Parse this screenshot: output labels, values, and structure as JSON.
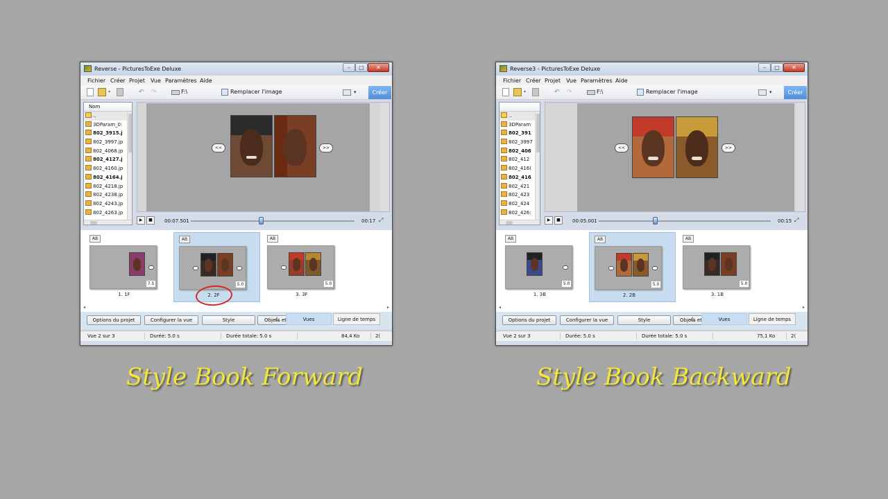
{
  "colors": {
    "background": "#a7a7a7",
    "caption": "#f3e63a",
    "selection": "#c7dcef",
    "create_button": "#5b9be3",
    "annotation": "#d62828"
  },
  "windows": [
    {
      "title": "Reverse - PicturesToExe Deluxe",
      "menu": [
        "Fichier",
        "Créer",
        "Projet",
        "Vue",
        "Paramètres",
        "Aide"
      ],
      "toolbar": {
        "drive": "F:\\",
        "replace_image": "Remplacer l'image",
        "create": "Créer",
        "undo_icon": "undo-icon",
        "redo_icon": "redo-icon"
      },
      "file_panel": {
        "header": "Nom",
        "items": [
          {
            "name": "..",
            "type": "folder",
            "bold": false
          },
          {
            "name": "3DParam_0:",
            "type": "file",
            "bold": false
          },
          {
            "name": "802_3915.j",
            "type": "file",
            "bold": true
          },
          {
            "name": "802_3997.jp",
            "type": "file",
            "bold": false
          },
          {
            "name": "802_4068.jp",
            "type": "file",
            "bold": false
          },
          {
            "name": "802_4127.j",
            "type": "file",
            "bold": true
          },
          {
            "name": "802_4160.jp",
            "type": "file",
            "bold": false
          },
          {
            "name": "802_4164.j",
            "type": "file",
            "bold": true
          },
          {
            "name": "802_4218.jp",
            "type": "file",
            "bold": false
          },
          {
            "name": "802_4238.jp",
            "type": "file",
            "bold": false
          },
          {
            "name": "802_4243.jp",
            "type": "file",
            "bold": false
          },
          {
            "name": "802_4263.jp",
            "type": "file",
            "bold": false
          }
        ]
      },
      "preview": {
        "prev": "<<",
        "next": ">>"
      },
      "transport": {
        "current_time": "00:07.501",
        "total_time": "00:17",
        "progress": 0.43
      },
      "slides": [
        {
          "ab": "AB",
          "duration": "7.5",
          "label": "1. 1F"
        },
        {
          "ab": "AB",
          "duration": "5.0",
          "label": "2. 2F"
        },
        {
          "ab": "AB",
          "duration": "5.0",
          "label": "3. 3F"
        }
      ],
      "selected_slide": 1,
      "bottom": {
        "project_options": "Options du projet",
        "configure_view": "Configurer la vue",
        "style": "Style",
        "objects": "Objets et animation",
        "vues": "Vues",
        "timeline": "Ligne de temps"
      },
      "status": {
        "view": "Vue 2 sur 3",
        "duration": "Durée: 5.0 s",
        "total": "Durée totale: 5.0 s",
        "size": "84,4 Ko",
        "extra": "2("
      }
    },
    {
      "title": "Reverse3 - PicturesToExe Deluxe",
      "menu": [
        "Fichier",
        "Créer",
        "Projet",
        "Vue",
        "Paramètres",
        "Aide"
      ],
      "toolbar": {
        "drive": "F:\\",
        "replace_image": "Remplacer l'image",
        "create": "Créer",
        "undo_icon": "undo-icon",
        "redo_icon": "redo-icon"
      },
      "file_panel": {
        "header": "",
        "items": [
          {
            "name": "..",
            "type": "folder",
            "bold": false
          },
          {
            "name": "3DParam",
            "type": "file",
            "bold": false
          },
          {
            "name": "802_391",
            "type": "file",
            "bold": true
          },
          {
            "name": "802_3997",
            "type": "file",
            "bold": false
          },
          {
            "name": "802_406",
            "type": "file",
            "bold": true
          },
          {
            "name": "802_412",
            "type": "file",
            "bold": false
          },
          {
            "name": "802_416(",
            "type": "file",
            "bold": false
          },
          {
            "name": "802_416",
            "type": "file",
            "bold": true
          },
          {
            "name": "802_421",
            "type": "file",
            "bold": false
          },
          {
            "name": "802_423",
            "type": "file",
            "bold": false
          },
          {
            "name": "802_424",
            "type": "file",
            "bold": false
          },
          {
            "name": "802_426:",
            "type": "file",
            "bold": false
          }
        ]
      },
      "preview": {
        "prev": "<<",
        "next": ">>"
      },
      "transport": {
        "current_time": "00:05.001",
        "total_time": "00:15",
        "progress": 0.33
      },
      "slides": [
        {
          "ab": "AB",
          "duration": "5.0",
          "label": "1. 3B"
        },
        {
          "ab": "AB",
          "duration": "5.0",
          "label": "2. 2B"
        },
        {
          "ab": "AB",
          "duration": "5.0",
          "label": "3. 1B"
        }
      ],
      "selected_slide": 1,
      "bottom": {
        "project_options": "Options du projet",
        "configure_view": "Configurer la vue",
        "style": "Style",
        "objects": "Objets et animation",
        "vues": "Vues",
        "timeline": "Ligne de temps"
      },
      "status": {
        "view": "Vue 2 sur 3",
        "duration": "Durée: 5.0 s",
        "total": "Durée totale: 5.0 s",
        "size": "75,1 Ko",
        "extra": "2("
      }
    }
  ],
  "captions": {
    "left": "Style Book Forward",
    "right": "Style Book Backward"
  }
}
